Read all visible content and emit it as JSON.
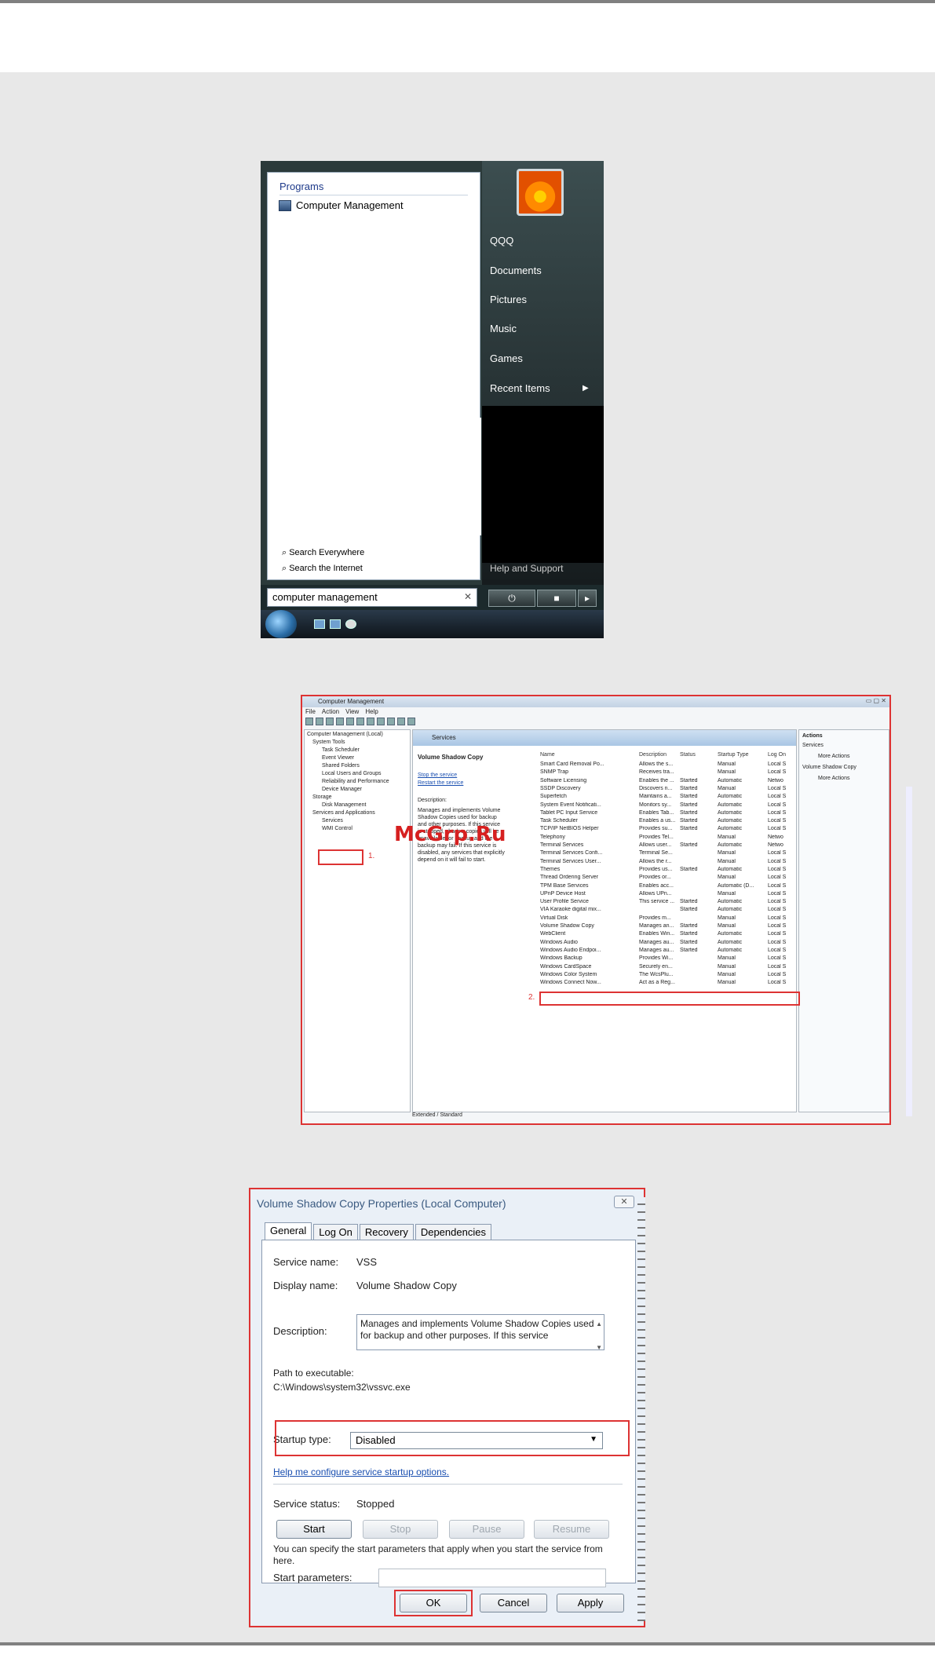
{
  "start_menu": {
    "programs_heading": "Programs",
    "program_item": "Computer Management",
    "search_everywhere": "Search Everywhere",
    "search_internet": "Search the Internet",
    "search_value": "computer management",
    "right_items": [
      "QQQ",
      "Documents",
      "Pictures",
      "Music",
      "Games",
      "Recent Items"
    ],
    "help_support": "Help and Support"
  },
  "computer_management": {
    "title": "Computer Management",
    "menu": [
      "File",
      "Action",
      "View",
      "Help"
    ],
    "tree": [
      "Computer Management (Local)",
      "System Tools",
      "Task Scheduler",
      "Event Viewer",
      "Shared Folders",
      "Local Users and Groups",
      "Reliability and Performance",
      "Device Manager",
      "Storage",
      "Disk Management",
      "Services and Applications",
      "Services",
      "WMI Control"
    ],
    "mid_header": "Services",
    "selected_service": "Volume Shadow Copy",
    "stop_link": "Stop the service",
    "restart_link": "Restart the service",
    "description_label": "Description:",
    "description": "Manages and implements Volume Shadow Copies used for backup and other purposes. If this service is stopped, shadow copies will be unavailable for backup and the backup may fail. If this service is disabled, any services that explicitly depend on it will fail to start.",
    "columns": [
      "Name",
      "Description",
      "Status",
      "Startup Type",
      "Log On"
    ],
    "rows": [
      [
        "Smart Card Removal Po...",
        "Allows the s...",
        "",
        "Manual",
        "Local S"
      ],
      [
        "SNMP Trap",
        "Receives tra...",
        "",
        "Manual",
        "Local S"
      ],
      [
        "Software Licensing",
        "Enables the ...",
        "Started",
        "Automatic",
        "Netwo"
      ],
      [
        "SSDP Discovery",
        "Discovers n...",
        "Started",
        "Manual",
        "Local S"
      ],
      [
        "Superfetch",
        "Maintains a...",
        "Started",
        "Automatic",
        "Local S"
      ],
      [
        "System Event Notificati...",
        "Monitors sy...",
        "Started",
        "Automatic",
        "Local S"
      ],
      [
        "Tablet PC Input Service",
        "Enables Tab...",
        "Started",
        "Automatic",
        "Local S"
      ],
      [
        "Task Scheduler",
        "Enables a us...",
        "Started",
        "Automatic",
        "Local S"
      ],
      [
        "TCP/IP NetBIOS Helper",
        "Provides su...",
        "Started",
        "Automatic",
        "Local S"
      ],
      [
        "Telephony",
        "Provides Tel...",
        "",
        "Manual",
        "Netwo"
      ],
      [
        "Terminal Services",
        "Allows user...",
        "Started",
        "Automatic",
        "Netwo"
      ],
      [
        "Terminal Services Confi...",
        "Terminal Se...",
        "",
        "Manual",
        "Local S"
      ],
      [
        "Terminal Services User...",
        "Allows the r...",
        "",
        "Manual",
        "Local S"
      ],
      [
        "Themes",
        "Provides us...",
        "Started",
        "Automatic",
        "Local S"
      ],
      [
        "Thread Ordering Server",
        "Provides or...",
        "",
        "Manual",
        "Local S"
      ],
      [
        "TPM Base Services",
        "Enables acc...",
        "",
        "Automatic (D...",
        "Local S"
      ],
      [
        "UPnP Device Host",
        "Allows UPn...",
        "",
        "Manual",
        "Local S"
      ],
      [
        "User Profile Service",
        "This service ...",
        "Started",
        "Automatic",
        "Local S"
      ],
      [
        "VIA Karaoke digital mix...",
        "",
        "Started",
        "Automatic",
        "Local S"
      ],
      [
        "Virtual Disk",
        "Provides m...",
        "",
        "Manual",
        "Local S"
      ],
      [
        "Volume Shadow Copy",
        "Manages an...",
        "Started",
        "Manual",
        "Local S"
      ],
      [
        "WebClient",
        "Enables Win...",
        "Started",
        "Automatic",
        "Local S"
      ],
      [
        "Windows Audio",
        "Manages au...",
        "Started",
        "Automatic",
        "Local S"
      ],
      [
        "Windows Audio Endpoi...",
        "Manages au...",
        "Started",
        "Automatic",
        "Local S"
      ],
      [
        "Windows Backup",
        "Provides Wi...",
        "",
        "Manual",
        "Local S"
      ],
      [
        "Windows CardSpace",
        "Securely en...",
        "",
        "Manual",
        "Local S"
      ],
      [
        "Windows Color System",
        "The WcsPlu...",
        "",
        "Manual",
        "Local S"
      ],
      [
        "Windows Connect Now...",
        "Act as a Reg...",
        "",
        "Manual",
        "Local S"
      ]
    ],
    "actions_header": "Actions",
    "actions": [
      "Services",
      "More Actions",
      "Volume Shadow Copy",
      "More Actions"
    ],
    "tabs": [
      "Extended",
      "Standard"
    ],
    "step1": "1.",
    "step2": "2.",
    "watermark": "McGrp.Ru"
  },
  "properties": {
    "title": "Volume Shadow Copy Properties (Local Computer)",
    "close": "✕",
    "tabs": [
      "General",
      "Log On",
      "Recovery",
      "Dependencies"
    ],
    "service_name_label": "Service name:",
    "service_name": "VSS",
    "display_name_label": "Display name:",
    "display_name": "Volume Shadow Copy",
    "description_label": "Description:",
    "description": "Manages and implements Volume Shadow Copies used for backup and other purposes. If this service",
    "path_label": "Path to executable:",
    "path": "C:\\Windows\\system32\\vssvc.exe",
    "startup_label": "Startup type:",
    "startup_value": "Disabled",
    "help_link": "Help me configure service startup options.",
    "status_label": "Service status:",
    "status_value": "Stopped",
    "btn_start": "Start",
    "btn_stop": "Stop",
    "btn_pause": "Pause",
    "btn_resume": "Resume",
    "hint": "You can specify the start parameters that apply when you start the service from here.",
    "params_label": "Start parameters:",
    "btn_ok": "OK",
    "btn_cancel": "Cancel",
    "btn_apply": "Apply"
  }
}
